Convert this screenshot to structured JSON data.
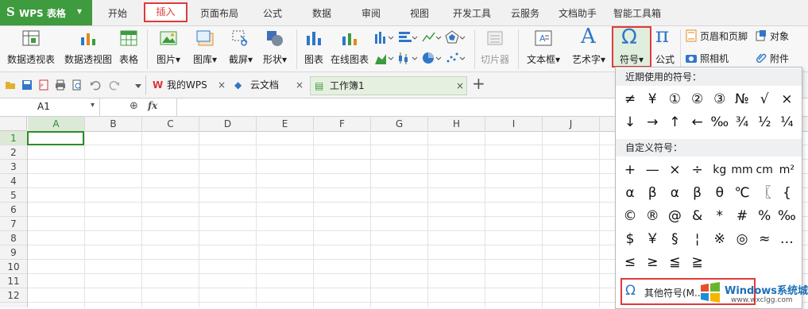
{
  "app": {
    "logo": "S",
    "title": "WPS 表格",
    "dropdown_arrow": "▾"
  },
  "menu": {
    "tabs": [
      "开始",
      "插入",
      "页面布局",
      "公式",
      "数据",
      "审阅",
      "视图",
      "开发工具",
      "云服务",
      "文档助手",
      "智能工具箱"
    ],
    "active": "插入"
  },
  "ribbon": {
    "pivot_table": "数据透视表",
    "pivot_chart": "数据透视图",
    "table": "表格",
    "picture": "图片",
    "gallery": "图库",
    "screenshot": "截屏",
    "shape": "形状",
    "chart": "图表",
    "online_chart": "在线图表",
    "slicer": "切片器",
    "textbox": "文本框",
    "wordart": "艺术字",
    "symbol": "符号",
    "formula": "公式",
    "header_footer": "页眉和页脚",
    "object": "对象",
    "camera": "照相机",
    "attachment": "附件",
    "symbol_glyph": "Ω",
    "formula_glyph": "π",
    "wordart_glyph": "A",
    "dd": "▾"
  },
  "tabstrip": {
    "tabs": [
      {
        "icon": "W",
        "label": "我的WPS"
      },
      {
        "icon": "◆",
        "label": "云文档"
      },
      {
        "icon": "▤",
        "label": "工作簿1"
      }
    ],
    "close": "×",
    "add": "+"
  },
  "formula_bar": {
    "cell_ref": "A1",
    "dd": "▾",
    "zoom_icon": "⊕",
    "fx": "fx",
    "value": ""
  },
  "grid": {
    "columns": [
      "A",
      "B",
      "C",
      "D",
      "E",
      "F",
      "G",
      "H",
      "I",
      "J"
    ],
    "rows": [
      "1",
      "2",
      "3",
      "4",
      "5",
      "6",
      "7",
      "8",
      "9",
      "10",
      "11",
      "12"
    ]
  },
  "symbol_menu": {
    "recent_title": "近期使用的符号：",
    "recent": [
      "≠",
      "¥",
      "①",
      "②",
      "③",
      "№",
      "√",
      "×",
      "↓",
      "→",
      "↑",
      "←",
      "‰",
      "¾",
      "½",
      "¼"
    ],
    "custom_title": "自定义符号：",
    "custom": [
      "+",
      "—",
      "×",
      "÷",
      "kg",
      "mm",
      "cm",
      "m²",
      "α",
      "β",
      "α",
      "β",
      "θ",
      "℃",
      "〖",
      "{",
      "©",
      "®",
      "@",
      "&",
      "*",
      "#",
      "%",
      "‰",
      "$",
      "￥",
      "§",
      "¦",
      "※",
      "◎",
      "≈",
      "…",
      "≤",
      "≥",
      "≦",
      "≧"
    ],
    "more_icon": "Ω",
    "more_label": "其他符号(M..."
  },
  "watermark": {
    "brand": "Windows系统城",
    "url": "www.wxclgg.com"
  },
  "colors": {
    "accent_green": "#3e9b3e",
    "highlight_red": "#e03a3a",
    "selection": "#2a8d2a",
    "blue_icon": "#2f77c8"
  }
}
